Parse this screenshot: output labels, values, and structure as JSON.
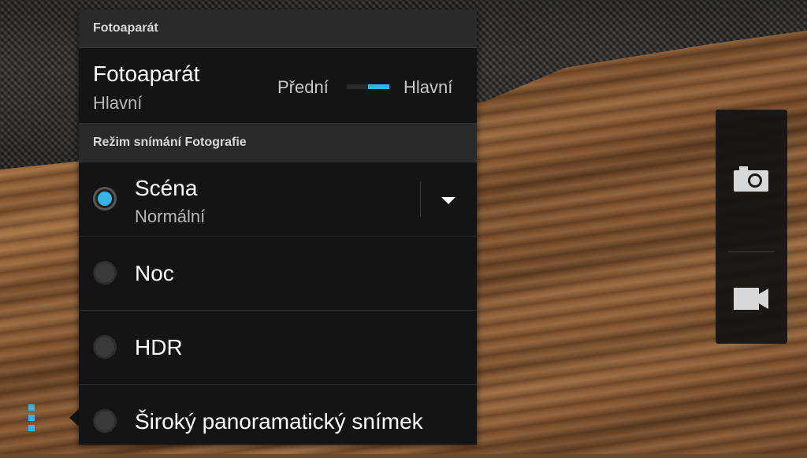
{
  "panel": {
    "section1_header": "Fotoaparát",
    "camera_row": {
      "title": "Fotoaparát",
      "subtitle": "Hlavní",
      "switch_left": "Přední",
      "switch_right": "Hlavní"
    },
    "section2_header": "Režim snímání Fotografie",
    "modes": [
      {
        "label": "Scéna",
        "sub": "Normální",
        "selected": true
      },
      {
        "label": "Noc",
        "selected": false
      },
      {
        "label": "HDR",
        "selected": false
      },
      {
        "label": "Široký panoramatický snímek",
        "selected": false
      }
    ]
  },
  "mode_switcher": {
    "icons": [
      "camera-icon",
      "video-camera-icon"
    ]
  },
  "colors": {
    "accent": "#33b5e5",
    "panel_bg": "#141414",
    "header_bg": "#2a2a2a"
  }
}
